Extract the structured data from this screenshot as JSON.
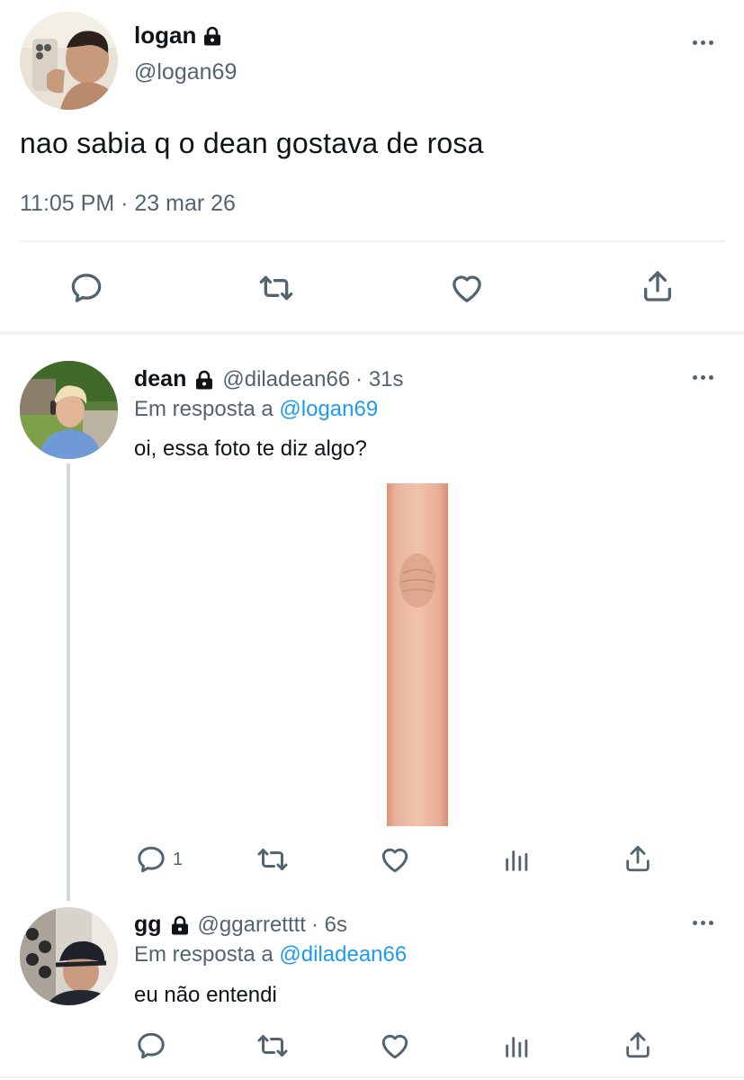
{
  "main_tweet": {
    "display_name": "logan",
    "handle": "@logan69",
    "text": "nao sabia q o dean gostava de rosa",
    "timestamp": "11:05 PM · 23 mar 26",
    "actions": [
      "reply-icon",
      "retweet-icon",
      "like-icon",
      "share-icon"
    ]
  },
  "reply1": {
    "display_name": "dean",
    "handle": "@diladean66",
    "time": "· 31s",
    "replying_prefix": "Em resposta a",
    "replying_to": "@logan69",
    "text": "oi, essa foto te diz algo?",
    "reply_count": "1"
  },
  "reply2": {
    "display_name": "gg",
    "handle": "@ggarretttt",
    "time": "· 6s",
    "replying_prefix": "Em resposta a",
    "replying_to": "@diladean66",
    "text": "eu não entendi"
  },
  "colors": {
    "text": "#0f1419",
    "secondary": "#536471",
    "link": "#1d9bf0",
    "divider": "#eff3f4",
    "thread_line": "#cfd9de"
  }
}
